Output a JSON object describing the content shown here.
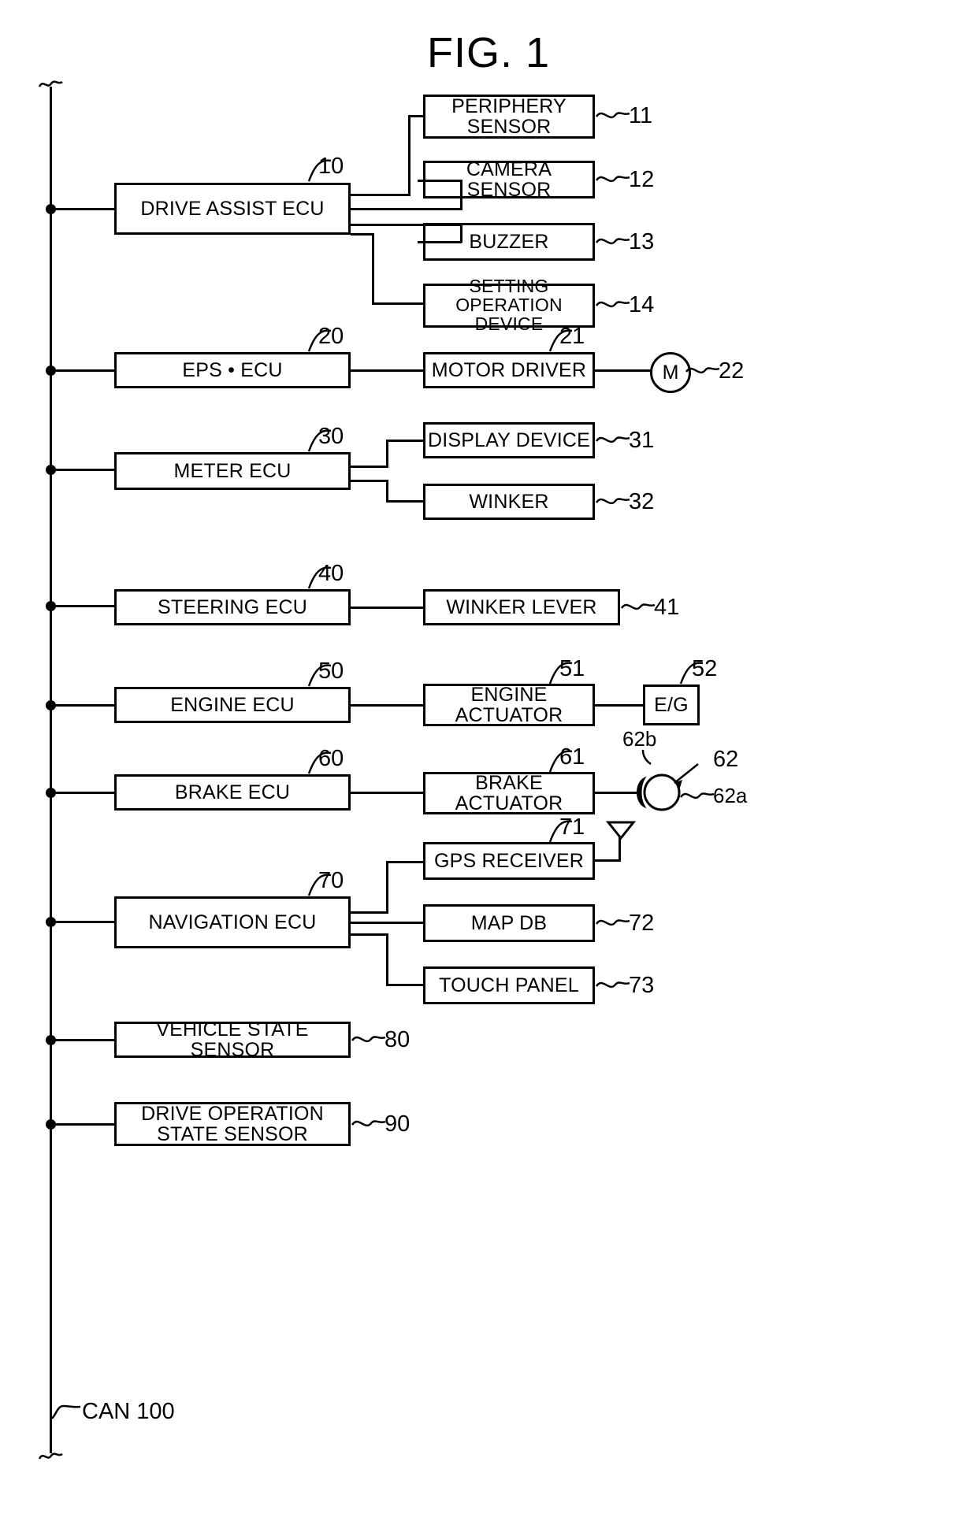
{
  "figure": {
    "title": "FIG. 1",
    "bus_label": "CAN 100"
  },
  "nodes": {
    "drive_assist_ecu": {
      "label": "DRIVE ASSIST ECU",
      "ref": "10"
    },
    "periphery_sensor": {
      "label_line1": "PERIPHERY",
      "label_line2": "SENSOR",
      "ref": "11"
    },
    "camera_sensor": {
      "label": "CAMERA SENSOR",
      "ref": "12"
    },
    "buzzer": {
      "label": "BUZZER",
      "ref": "13"
    },
    "setting_operation_device": {
      "label_line1": "SETTING",
      "label_line2": "OPERATION DEVICE",
      "ref": "14"
    },
    "eps_ecu": {
      "label": "EPS • ECU",
      "ref": "20"
    },
    "motor_driver": {
      "label": "MOTOR DRIVER",
      "ref": "21"
    },
    "motor": {
      "label": "M",
      "ref": "22"
    },
    "meter_ecu": {
      "label": "METER ECU",
      "ref": "30"
    },
    "display_device": {
      "label": "DISPLAY DEVICE",
      "ref": "31"
    },
    "winker": {
      "label": "WINKER",
      "ref": "32"
    },
    "steering_ecu": {
      "label": "STEERING ECU",
      "ref": "40"
    },
    "winker_lever": {
      "label": "WINKER LEVER",
      "ref": "41"
    },
    "engine_ecu": {
      "label": "ENGINE ECU",
      "ref": "50"
    },
    "engine_actuator": {
      "label_line1": "ENGINE",
      "label_line2": "ACTUATOR",
      "ref": "51"
    },
    "engine": {
      "label": "E/G",
      "ref": "52"
    },
    "brake_ecu": {
      "label": "BRAKE ECU",
      "ref": "60"
    },
    "brake_actuator": {
      "label_line1": "BRAKE",
      "label_line2": "ACTUATOR",
      "ref": "61"
    },
    "brake_disc": {
      "ref": "62",
      "ref_pad": "62b",
      "ref_disc": "62a"
    },
    "navigation_ecu": {
      "label": "NAVIGATION ECU",
      "ref": "70"
    },
    "gps_receiver": {
      "label": "GPS RECEIVER",
      "ref": "71"
    },
    "map_db": {
      "label": "MAP DB",
      "ref": "72"
    },
    "touch_panel": {
      "label": "TOUCH PANEL",
      "ref": "73"
    },
    "vehicle_state_sensor": {
      "label": "VEHICLE STATE SENSOR",
      "ref": "80"
    },
    "drive_operation_state_sensor": {
      "label_line1": "DRIVE OPERATION",
      "label_line2": "STATE SENSOR",
      "ref": "90"
    }
  }
}
